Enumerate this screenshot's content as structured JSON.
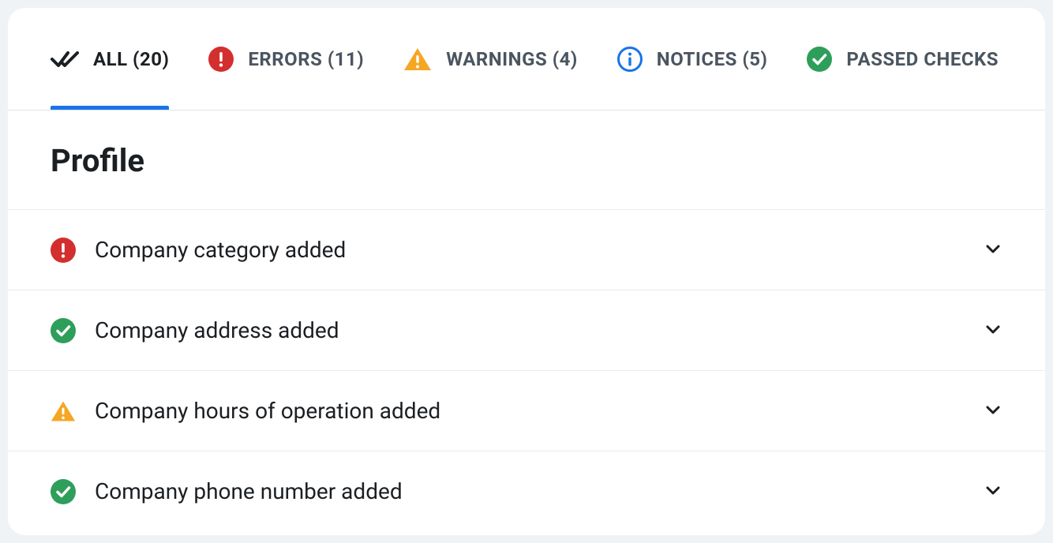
{
  "tabs": {
    "all": {
      "label": "ALL (20)"
    },
    "errors": {
      "label": "ERRORS (11)"
    },
    "warnings": {
      "label": "WARNINGS (4)"
    },
    "notices": {
      "label": "NOTICES (5)"
    },
    "passed": {
      "label": "PASSED CHECKS"
    }
  },
  "section": {
    "title": "Profile"
  },
  "items": [
    {
      "label": "Company category added"
    },
    {
      "label": "Company address added"
    },
    {
      "label": "Company hours of operation added"
    },
    {
      "label": "Company phone number added"
    }
  ],
  "colors": {
    "error": "#d32f2f",
    "success": "#2e9e5b",
    "warning": "#f5a623",
    "notice": "#1a73e8"
  }
}
